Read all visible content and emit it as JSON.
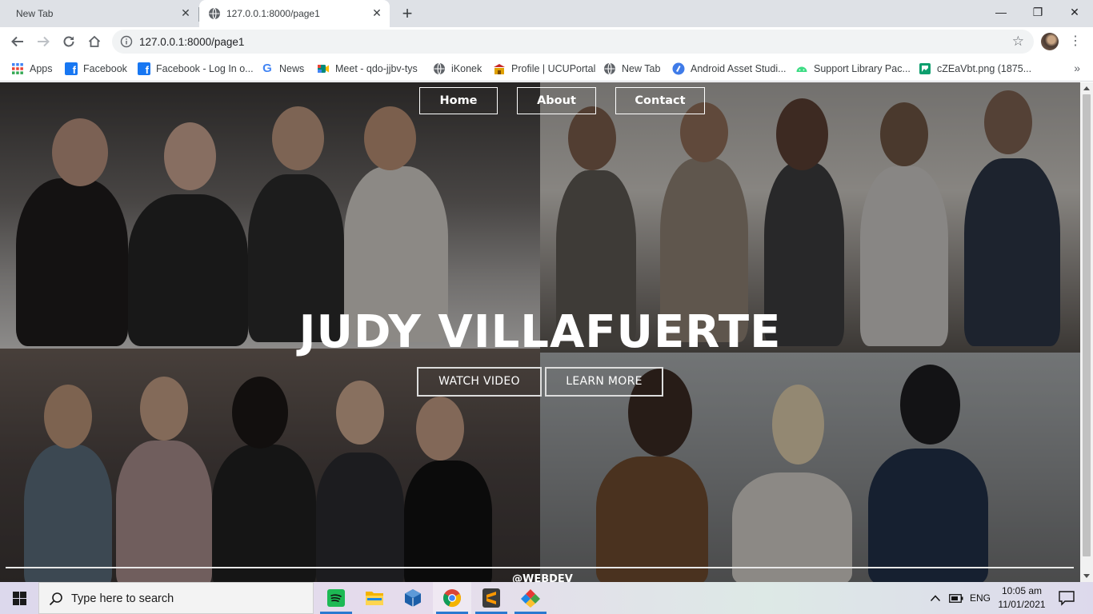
{
  "browser": {
    "tabs": [
      {
        "title": "New Tab"
      },
      {
        "title": "127.0.0.1:8000/page1"
      }
    ],
    "url": "127.0.0.1:8000/page1",
    "bookmarks": [
      {
        "label": "Apps",
        "icon": "apps-grid-icon",
        "color": "#4285f4"
      },
      {
        "label": "Facebook",
        "icon": "facebook-icon",
        "color": "#1877f2"
      },
      {
        "label": "Facebook - Log In o...",
        "icon": "facebook-icon",
        "color": "#1877f2"
      },
      {
        "label": "News",
        "icon": "google-icon",
        "color": "#ea4335"
      },
      {
        "label": "Meet - qdo-jjbv-tys",
        "icon": "meet-icon",
        "color": "#00897b"
      },
      {
        "label": "iKonek",
        "icon": "globe-icon",
        "color": "#5f6368"
      },
      {
        "label": "Profile | UCUPortal",
        "icon": "portal-icon",
        "color": "#e0a100"
      },
      {
        "label": "New Tab",
        "icon": "globe-icon",
        "color": "#5f6368"
      },
      {
        "label": "Android Asset Studi...",
        "icon": "android-studio-icon",
        "color": "#3f7be8"
      },
      {
        "label": "Support Library Pac...",
        "icon": "android-icon",
        "color": "#3ddc84"
      },
      {
        "label": "cZEaVbt.png (1875...",
        "icon": "image-icon",
        "color": "#0e9f6e"
      }
    ]
  },
  "site": {
    "nav": {
      "home": "Home",
      "about": "About",
      "contact": "Contact"
    },
    "hero": {
      "title": "JUDY VILLAFUERTE",
      "watch_video": "WATCH VIDEO",
      "learn_more": "LEARN MORE"
    },
    "footer": "@WEBDEV"
  },
  "taskbar": {
    "search_placeholder": "Type here to search",
    "apps": [
      "spotify-icon",
      "file-explorer-icon",
      "virtualbox-icon",
      "chrome-icon",
      "sublime-text-icon",
      "git-icon"
    ],
    "language": "ENG",
    "time": "10:05 am",
    "date": "11/01/2021"
  },
  "colors": {
    "hero_overlay": "rgba(0,0,0,0.32)",
    "taskbar_active": "#2b79d0"
  }
}
